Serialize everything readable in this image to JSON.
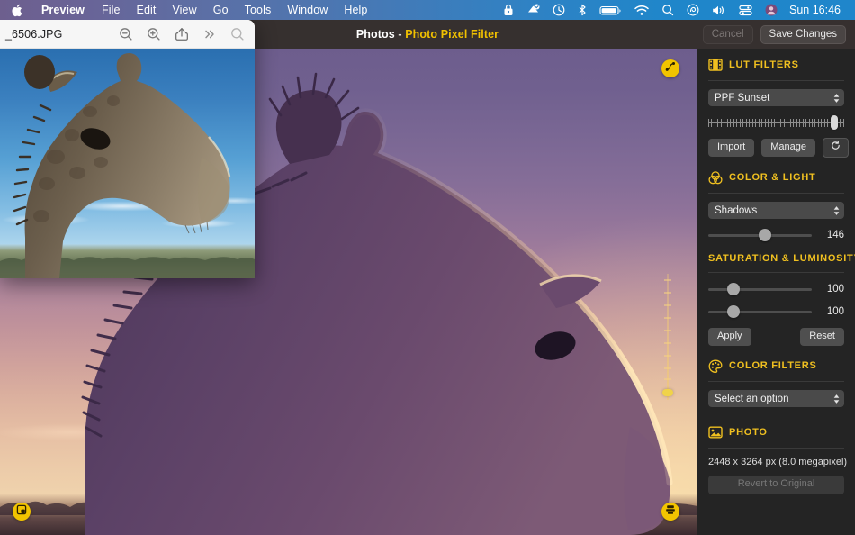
{
  "menubar": {
    "apple_icon": "apple-logo-icon",
    "items": [
      {
        "label": "Preview",
        "bold": true
      },
      {
        "label": "File",
        "bold": false
      },
      {
        "label": "Edit",
        "bold": false
      },
      {
        "label": "View",
        "bold": false
      },
      {
        "label": "Go",
        "bold": false
      },
      {
        "label": "Tools",
        "bold": false
      },
      {
        "label": "Window",
        "bold": false
      },
      {
        "label": "Help",
        "bold": false
      }
    ],
    "status_icons": [
      "screen-lock-icon",
      "shortcuts-icon",
      "clock-icon",
      "bluetooth-icon",
      "battery-icon",
      "wifi-icon",
      "spotlight-search-icon",
      "siri-icon",
      "volume-icon",
      "control-center-icon",
      "user-avatar-icon"
    ],
    "clock": "Sun 16:46"
  },
  "preview_window": {
    "filename": "_6506.JPG",
    "toolbar_icons": [
      "zoom-out-icon",
      "zoom-in-icon",
      "share-icon",
      "more-chevrons-icon",
      "search-icon"
    ]
  },
  "app": {
    "title_primary": "Photos",
    "title_separator": " - ",
    "title_accent": "Photo Pixel Filter",
    "cancel_label": "Cancel",
    "save_label": "Save Changes"
  },
  "canvas": {
    "float_buttons": [
      {
        "name": "curve-adjust-button",
        "icon": "curve-path-icon",
        "position": "top-right"
      },
      {
        "name": "crop-button",
        "icon": "crop-square-icon",
        "position": "bottom-left"
      },
      {
        "name": "export-button",
        "icon": "export-stack-icon",
        "position": "bottom-right"
      }
    ],
    "vertical_slider": {
      "name": "intensity-vertical-slider",
      "value_pct": 8
    }
  },
  "panel": {
    "lut_filters": {
      "heading": "LUT FILTERS",
      "icon": "film-strip-icon",
      "preset_value": "PPF Sunset",
      "intensity_pct": 90,
      "import_label": "Import",
      "manage_label": "Manage",
      "refresh_icon": "refresh-icon"
    },
    "color_light": {
      "heading": "COLOR & LIGHT",
      "icon": "venn-circles-icon",
      "channel_value": "Shadows",
      "slider_value": "146",
      "slider_pct": 55
    },
    "saturation_luminosity": {
      "heading": "SATURATION & LUMINOSITY",
      "sliders": [
        {
          "name": "saturation-slider",
          "value": "100",
          "pct": 24
        },
        {
          "name": "luminosity-slider",
          "value": "100",
          "pct": 24
        }
      ],
      "apply_label": "Apply",
      "reset_label": "Reset"
    },
    "color_filters": {
      "heading": "COLOR FILTERS",
      "icon": "palette-icon",
      "select_value": "Select an option"
    },
    "photo": {
      "heading": "PHOTO",
      "icon": "image-icon",
      "dimensions": "2448 x 3264 px (8.0 megapixel)",
      "revert_label": "Revert to Original"
    }
  },
  "colors": {
    "accent_yellow": "#f0c020",
    "panel_bg": "#242424",
    "titlebar_bg": "#36302f"
  }
}
